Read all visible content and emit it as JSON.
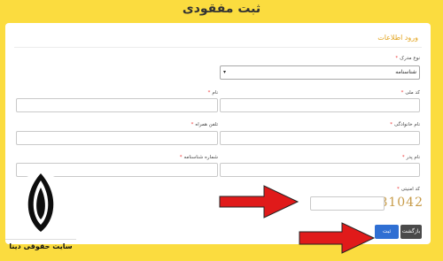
{
  "header": {
    "title": "ثبت مفقودی"
  },
  "form": {
    "section_title": "ورود اطلاعات",
    "required_mark": "*",
    "doc_type": {
      "label": "نوع مدرک",
      "value": "شناسنامه"
    },
    "national_code": {
      "label": "کد ملی"
    },
    "first_name": {
      "label": "نام"
    },
    "last_name": {
      "label": "نام خانوادگی"
    },
    "mobile": {
      "label": "تلفن همراه"
    },
    "father_name": {
      "label": "نام پدر"
    },
    "id_number": {
      "label": "شماره شناسنامه"
    },
    "security_code": {
      "label": "کد امنیتی",
      "captcha": "81042"
    },
    "buttons": {
      "back": "بازگشت",
      "submit": "ثبت"
    }
  },
  "branding": {
    "name": "سایت حقوقی دینا"
  },
  "colors": {
    "page_bg": "#fbdc3f",
    "accent": "#e2a21a",
    "arrow": "#e01a1a",
    "submit": "#2f6fd3"
  }
}
